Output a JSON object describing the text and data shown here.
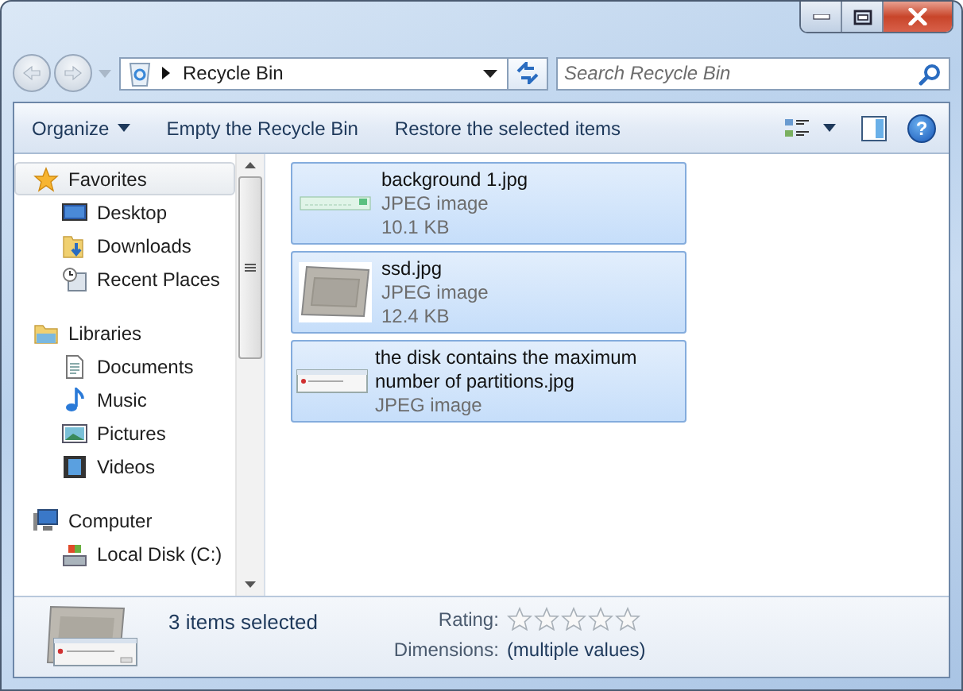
{
  "address": {
    "location": "Recycle Bin"
  },
  "search": {
    "placeholder": "Search Recycle Bin"
  },
  "toolbar": {
    "commands": [
      {
        "label": "Organize",
        "dropdown": true
      },
      {
        "label": "Empty the Recycle Bin",
        "dropdown": false
      },
      {
        "label": "Restore the selected items",
        "dropdown": false
      }
    ],
    "help": "?"
  },
  "navigation": [
    {
      "label": "Favorites",
      "selected": true,
      "children": [
        {
          "label": "Desktop",
          "selected": false
        },
        {
          "label": "Downloads",
          "selected": false
        },
        {
          "label": "Recent Places",
          "selected": false
        }
      ]
    },
    {
      "label": "Libraries",
      "selected": false,
      "children": [
        {
          "label": "Documents",
          "selected": false
        },
        {
          "label": "Music",
          "selected": false
        },
        {
          "label": "Pictures",
          "selected": false
        },
        {
          "label": "Videos",
          "selected": false
        }
      ]
    },
    {
      "label": "Computer",
      "selected": false,
      "children": [
        {
          "label": "Local Disk (C:)",
          "selected": false
        }
      ]
    }
  ],
  "files": [
    {
      "name": "background 1.jpg",
      "type": "JPEG image",
      "size": "10.1 KB",
      "selected": true
    },
    {
      "name": "ssd.jpg",
      "type": "JPEG image",
      "size": "12.4 KB",
      "selected": true
    },
    {
      "name": "the disk contains the maximum number of partitions.jpg",
      "type": "JPEG image",
      "selected": true
    }
  ],
  "details": {
    "summary": "3 items selected",
    "rating_label": "Rating:",
    "stars": 0,
    "dimensions_label": "Dimensions:",
    "dimensions": "(multiple values)"
  }
}
